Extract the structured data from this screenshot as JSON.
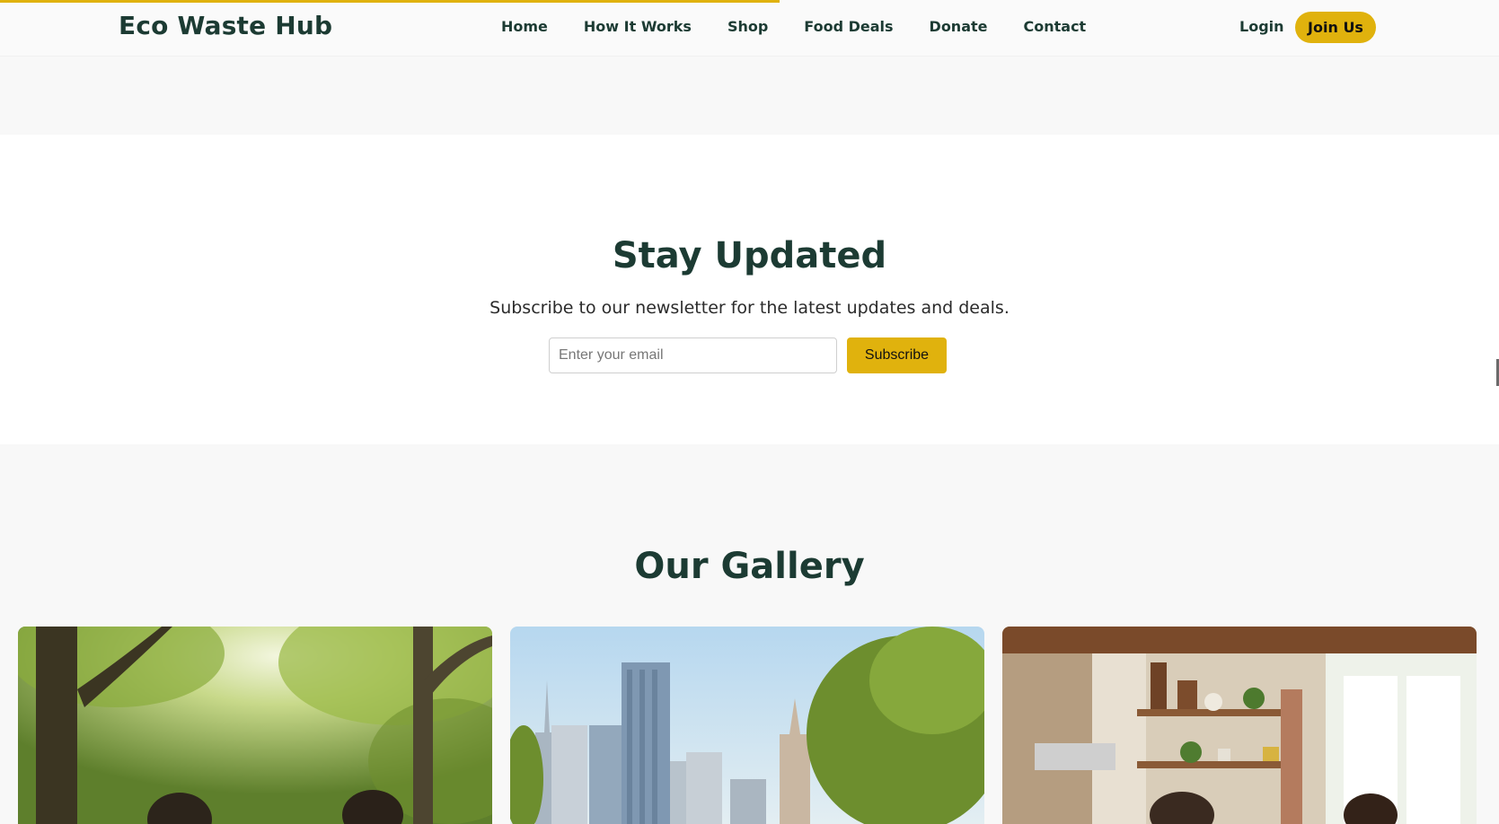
{
  "header": {
    "logo": "Eco Waste Hub",
    "nav": [
      {
        "label": "Home"
      },
      {
        "label": "How It Works"
      },
      {
        "label": "Shop"
      },
      {
        "label": "Food Deals"
      },
      {
        "label": "Donate"
      },
      {
        "label": "Contact"
      }
    ],
    "login_label": "Login",
    "join_label": "Join Us"
  },
  "newsletter": {
    "title": "Stay Updated",
    "subtitle": "Subscribe to our newsletter for the latest updates and deals.",
    "email_placeholder": "Enter your email",
    "email_value": "",
    "subscribe_label": "Subscribe"
  },
  "gallery": {
    "title": "Our Gallery",
    "images": [
      {
        "icon": "forest-people-image"
      },
      {
        "icon": "city-skyline-image"
      },
      {
        "icon": "kitchen-people-image"
      }
    ]
  },
  "colors": {
    "accent": "#e0b20d",
    "heading": "#1c3b33",
    "page_bg": "#f8f8f8",
    "section_bg": "#ffffff"
  },
  "scroll_progress": 0.52
}
